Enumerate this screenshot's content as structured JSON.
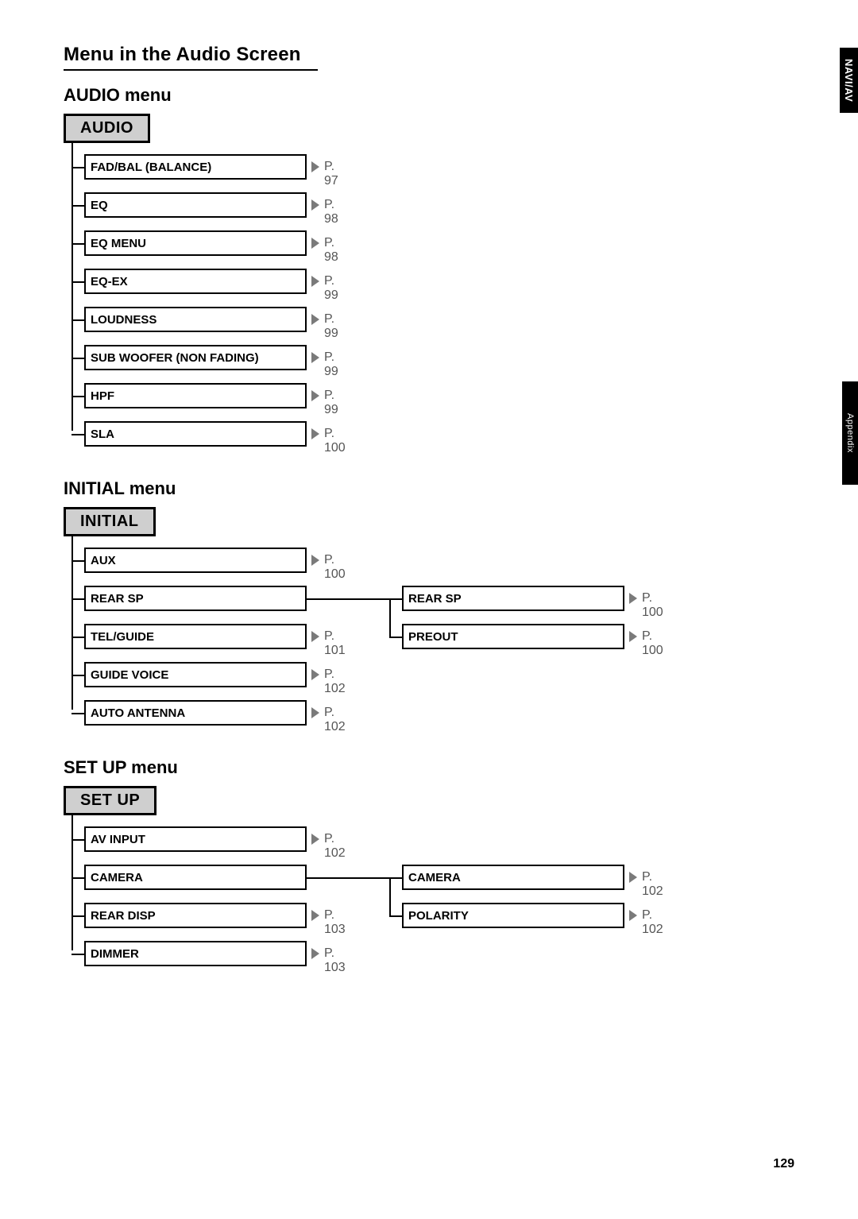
{
  "page_title": "Menu in the Audio Screen",
  "page_number": "129",
  "side_tabs": {
    "t1": "NAVI/AV",
    "t2": "Appendix"
  },
  "sections": {
    "audio": {
      "heading": "AUDIO menu",
      "head_label": "AUDIO",
      "items": [
        {
          "label": "FAD/BAL (BALANCE)",
          "page": "P. 97"
        },
        {
          "label": "EQ",
          "page": "P. 98"
        },
        {
          "label": "EQ MENU",
          "page": "P. 98"
        },
        {
          "label": "EQ-EX",
          "page": "P. 99"
        },
        {
          "label": "LOUDNESS",
          "page": "P. 99"
        },
        {
          "label": "SUB WOOFER (NON FADING)",
          "page": "P. 99"
        },
        {
          "label": "HPF",
          "page": "P. 99"
        },
        {
          "label": "SLA",
          "page": "P. 100"
        }
      ]
    },
    "initial": {
      "heading": "INITIAL menu",
      "head_label": "INITIAL",
      "items": [
        {
          "label": "AUX",
          "page": "P. 100"
        },
        {
          "label": "REAR SP",
          "page": "",
          "children": [
            {
              "label": "REAR SP",
              "page": "P. 100"
            },
            {
              "label": "PREOUT",
              "page": "P. 100"
            }
          ]
        },
        {
          "label": "TEL/GUIDE",
          "page": "P. 101"
        },
        {
          "label": "GUIDE VOICE",
          "page": "P. 102"
        },
        {
          "label": "AUTO ANTENNA",
          "page": "P. 102"
        }
      ]
    },
    "setup": {
      "heading": "SET UP menu",
      "head_label": "SET UP",
      "items": [
        {
          "label": "AV INPUT",
          "page": "P. 102"
        },
        {
          "label": "CAMERA",
          "page": "",
          "children": [
            {
              "label": "CAMERA",
              "page": "P. 102"
            },
            {
              "label": "POLARITY",
              "page": "P. 102"
            }
          ]
        },
        {
          "label": "REAR DISP",
          "page": "P. 103"
        },
        {
          "label": "DIMMER",
          "page": "P. 103"
        }
      ]
    }
  }
}
